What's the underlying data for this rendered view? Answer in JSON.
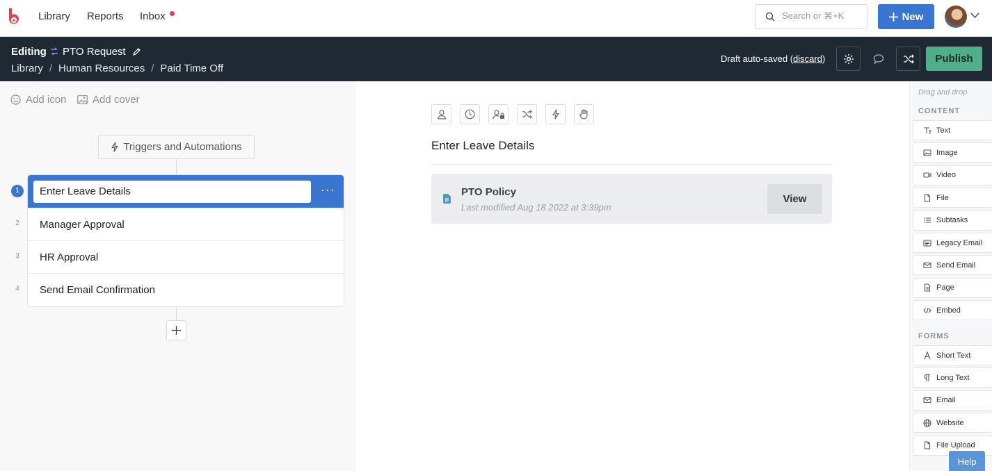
{
  "nav": {
    "links": [
      "Library",
      "Reports",
      "Inbox"
    ],
    "search_placeholder": "Search or ⌘+K",
    "new_label": "New"
  },
  "editbar": {
    "mode": "Editing",
    "workflow_name": "PTO Request",
    "breadcrumbs": [
      "Library",
      "Human Resources",
      "Paid Time Off"
    ],
    "draft_text": "Draft auto-saved (",
    "discard_label": "discard",
    "draft_close": ")",
    "publish_label": "Publish"
  },
  "left": {
    "add_icon_label": "Add icon",
    "add_cover_label": "Add cover",
    "triggers_label": "Triggers and Automations",
    "steps": [
      {
        "num": "1",
        "label": "Enter Leave Details"
      },
      {
        "num": "2",
        "label": "Manager Approval"
      },
      {
        "num": "3",
        "label": "HR Approval"
      },
      {
        "num": "4",
        "label": "Send Email Confirmation"
      }
    ],
    "more_label": "···"
  },
  "main": {
    "step_title": "Enter Leave Details",
    "file_card": {
      "name": "PTO Policy",
      "meta": "Last modified Aug 18 2022 at 3:39pm",
      "view_label": "View"
    }
  },
  "sidebar": {
    "hint": "Drag and drop",
    "content_heading": "CONTENT",
    "content_items": [
      {
        "label": "Text",
        "icon": "text-icon"
      },
      {
        "label": "Image",
        "icon": "image-icon"
      },
      {
        "label": "Video",
        "icon": "video-icon"
      },
      {
        "label": "File",
        "icon": "file-icon"
      },
      {
        "label": "Subtasks",
        "icon": "list-icon"
      },
      {
        "label": "Legacy Email",
        "icon": "legacy-email-icon"
      },
      {
        "label": "Send Email",
        "icon": "email-icon"
      },
      {
        "label": "Page",
        "icon": "page-icon"
      },
      {
        "label": "Embed",
        "icon": "code-icon"
      }
    ],
    "forms_heading": "FORMS",
    "form_items": [
      {
        "label": "Short Text",
        "icon": "font-icon"
      },
      {
        "label": "Long Text",
        "icon": "paragraph-icon"
      },
      {
        "label": "Email",
        "icon": "email-icon"
      },
      {
        "label": "Website",
        "icon": "globe-icon"
      },
      {
        "label": "File Upload",
        "icon": "file-icon"
      }
    ]
  },
  "help_label": "Help",
  "colors": {
    "primary": "#3975d1",
    "publish": "#4faf8b",
    "editbar": "#1f2933",
    "logo": "#e0414e"
  }
}
